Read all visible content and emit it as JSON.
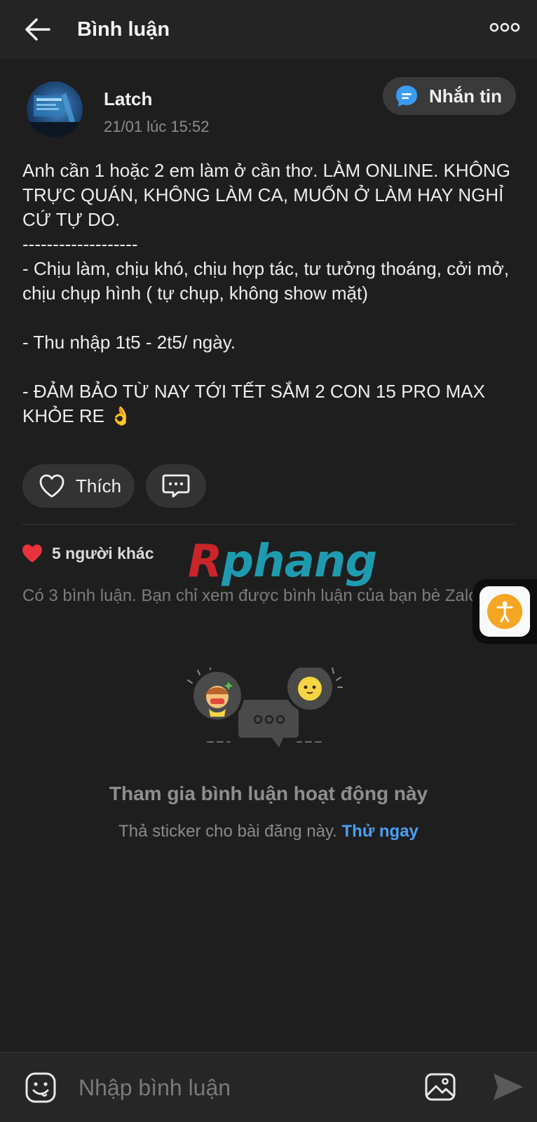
{
  "header": {
    "title": "Bình luận"
  },
  "post": {
    "author": "Latch",
    "time": "21/01 lúc 15:52",
    "message_button": "Nhắn tin",
    "body": [
      "Anh cần 1 hoặc 2 em làm ở cần thơ. LÀM ONLINE. KHÔNG TRỰC QUÁN, KHÔNG LÀM CA, MUỐN Ở LÀM HAY NGHỈ CỨ TỰ DO.",
      "-------------------",
      "- Chịu làm, chịu khó, chịu hợp tác, tư tưởng thoáng, cởi mở, chịu chụp hình ( tự chụp, không show mặt)",
      "- Thu nhập 1t5 - 2t5/ ngày.",
      "- ĐẢM BẢO TỪ NAY TỚI TẾT SẮM 2 CON 15 PRO MAX KHỎE RE 👌"
    ],
    "like_label": "Thích",
    "likes_text": "5 người khác"
  },
  "watermark": {
    "first": "R",
    "rest": "phang"
  },
  "comments": {
    "notice": "Có 3 bình luận. Bạn chỉ xem được bình luận của bạn bè Zalo.",
    "empty_title": "Tham gia bình luận hoạt động này",
    "empty_sub": "Thả sticker cho bài đăng này.",
    "try_link": "Thử ngay"
  },
  "composer": {
    "placeholder": "Nhập bình luận"
  },
  "colors": {
    "background": "#1e1e1e",
    "header": "#242424",
    "link": "#4c9ff3",
    "heart": "#e8323c",
    "accent_orange": "#f5a623"
  },
  "icons": [
    "back-arrow-icon",
    "more-dots-icon",
    "chat-bubble-icon",
    "heart-outline-icon",
    "comment-icon",
    "heart-filled-icon",
    "accessibility-icon",
    "emoji-icon",
    "image-icon",
    "send-icon"
  ]
}
